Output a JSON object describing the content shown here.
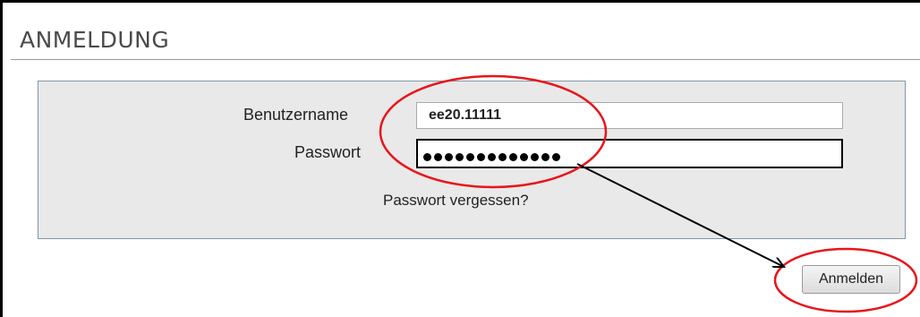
{
  "header": {
    "title": "ANMELDUNG"
  },
  "login": {
    "username_label": "Benutzername",
    "username_value": "ee20.11111",
    "password_label": "Passwort",
    "password_mask_length": 13,
    "forgot_label": "Passwort vergessen?",
    "submit_label": "Anmelden"
  },
  "colors": {
    "panel_bg": "#e9e9e9",
    "panel_border": "#7f97a6",
    "annotation": "#e8151b"
  },
  "icons": {
    "annotation_circle": "red-ellipse-icon",
    "annotation_arrow": "arrow-icon"
  }
}
